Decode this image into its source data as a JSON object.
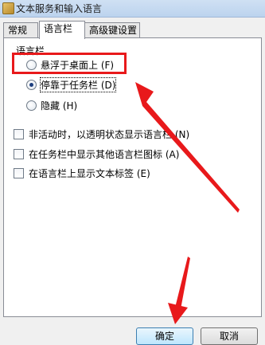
{
  "window": {
    "title": "文本服务和输入语言"
  },
  "tabs": [
    {
      "label": "常规"
    },
    {
      "label": "语言栏"
    },
    {
      "label": "高级键设置"
    }
  ],
  "langbar": {
    "group_title": "语言栏",
    "radios": [
      {
        "label": "悬浮于桌面上 (F)",
        "checked": false
      },
      {
        "label": "停靠于任务栏 (D)",
        "checked": true
      },
      {
        "label": "隐藏 (H)",
        "checked": false
      }
    ],
    "checkboxes": [
      {
        "label": "非活动时，以透明状态显示语言栏 (N)",
        "checked": false
      },
      {
        "label": "在任务栏中显示其他语言栏图标 (A)",
        "checked": false
      },
      {
        "label": "在语言栏上显示文本标签 (E)",
        "checked": false
      }
    ]
  },
  "buttons": {
    "ok": "确定",
    "cancel": "取消"
  },
  "annotations": {
    "highlight_color": "#e8191b",
    "arrow_color": "#e8191b"
  }
}
